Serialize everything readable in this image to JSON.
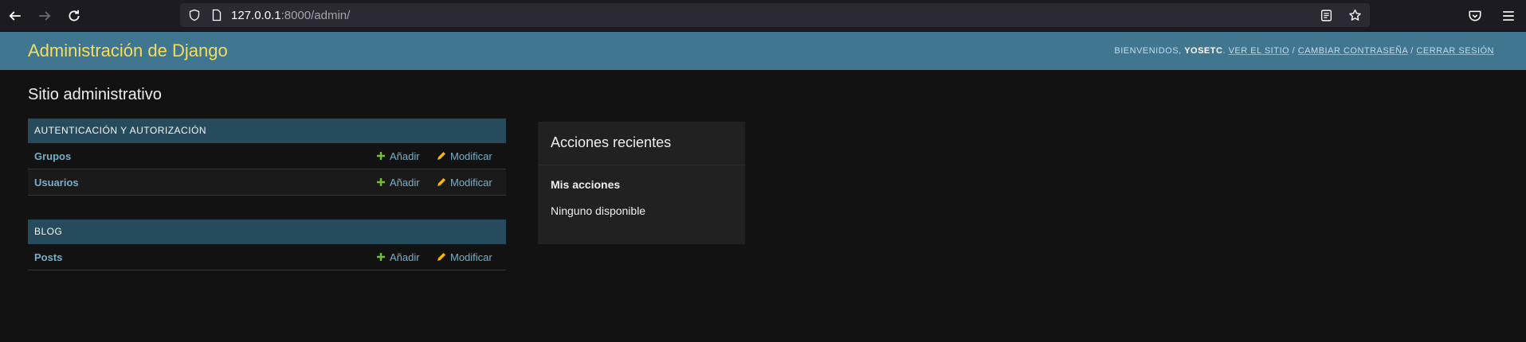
{
  "browser": {
    "url_host": "127.0.0.1",
    "url_rest": ":8000/admin/"
  },
  "header": {
    "site_name": "Administración de Django",
    "welcome": "Bienvenidos,",
    "username": "yosetc",
    "username_suffix": ".",
    "view_site": "Ver el sitio",
    "change_password": "Cambiar contraseña",
    "logout": "Cerrar sesión",
    "separator": "/"
  },
  "main": {
    "title": "Sitio administrativo",
    "add_label": "Añadir",
    "change_label": "Modificar",
    "apps": [
      {
        "caption": "Autenticación y autorización",
        "models": [
          "Grupos",
          "Usuarios"
        ]
      },
      {
        "caption": "Blog",
        "models": [
          "Posts"
        ]
      }
    ]
  },
  "recent_actions": {
    "title": "Acciones recientes",
    "subtitle": "Mis acciones",
    "empty": "Ninguno disponible"
  },
  "colors": {
    "header_bg": "#417690",
    "site_name": "#f5dd5d",
    "caption_bg": "#264b5d",
    "link": "#79aec8",
    "add_icon": "#70bf2b",
    "change_icon": "#efb80b"
  }
}
